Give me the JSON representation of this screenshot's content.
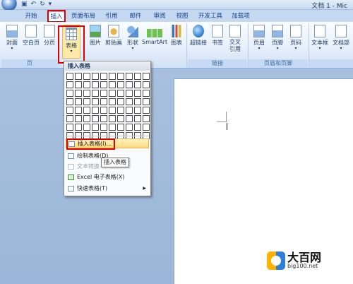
{
  "window": {
    "title": "文档 1 - Mic"
  },
  "tabs": [
    "开始",
    "插入",
    "页面布局",
    "引用",
    "邮件",
    "审阅",
    "视图",
    "开发工具",
    "加载项"
  ],
  "ribbon": {
    "buttons": {
      "cover": "封面",
      "blank": "空白页",
      "break": "分页",
      "table": "表格",
      "picture": "图片",
      "clipart": "剪贴画",
      "shapes": "形状",
      "smartart": "SmartArt",
      "chart": "图表",
      "hyperlink": "超链接",
      "bookmark": "书签",
      "crossref": "交叉\n引用",
      "header": "页眉",
      "footer": "页脚",
      "pagenum": "页码",
      "textbox": "文本框",
      "wordart": "文档部"
    },
    "groups": {
      "pages": "页",
      "links": "链接",
      "headerfooter": "页眉和页脚"
    }
  },
  "dropdown": {
    "title": "插入表格",
    "items": {
      "insert_table": "插入表格(I)...",
      "draw_table": "绘制表格(D)",
      "text_to_table": "文本转换",
      "excel": "Excel 电子表格(X)",
      "quick_table": "快速表格(T)"
    },
    "tooltip": "插入表格"
  },
  "watermark": {
    "name": "大百网",
    "url": "big100.net"
  }
}
